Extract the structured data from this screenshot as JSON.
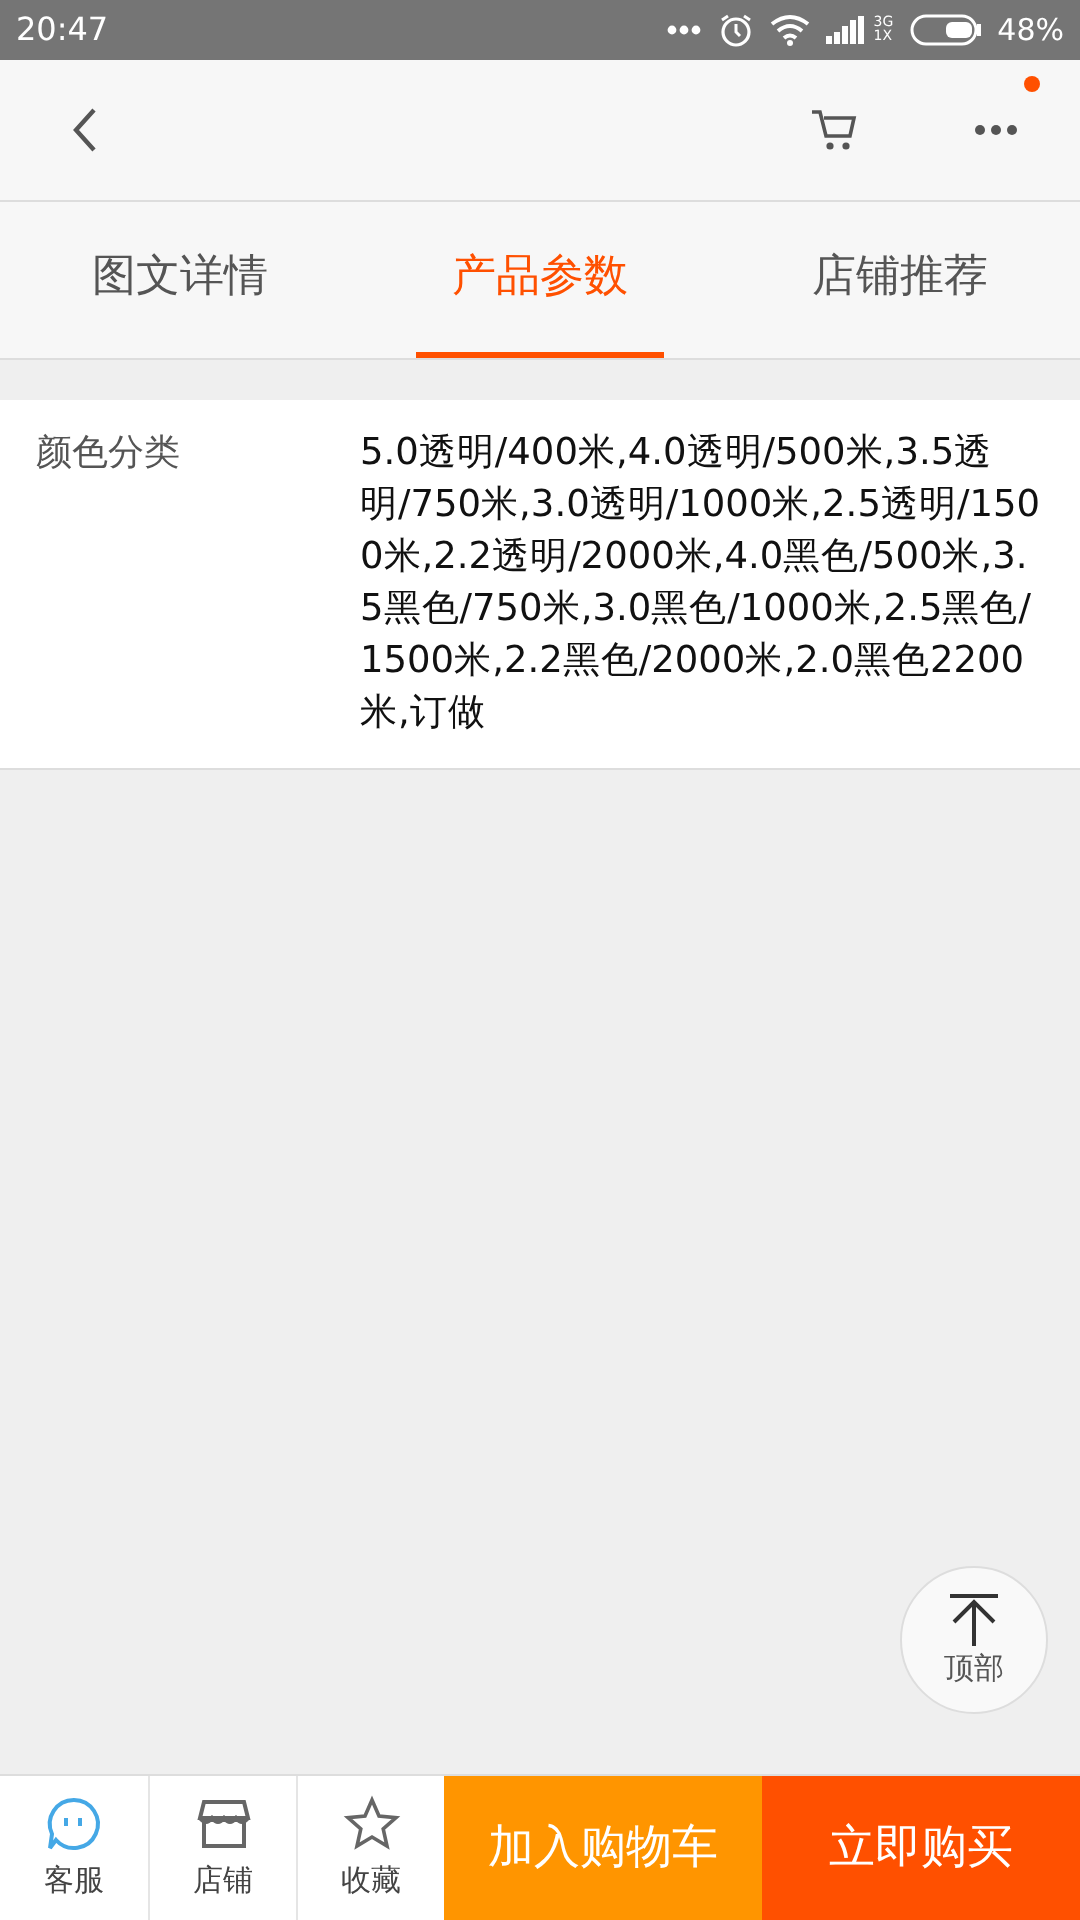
{
  "status_bar": {
    "time": "20:47",
    "network_type_top": "3G",
    "network_type_bottom": "1X",
    "battery": "48%"
  },
  "header": {
    "menu_badge": true
  },
  "tabs": [
    {
      "label": "图文详情",
      "selected": false
    },
    {
      "label": "产品参数",
      "selected": true
    },
    {
      "label": "店铺推荐",
      "selected": false
    }
  ],
  "params": [
    {
      "name": "颜色分类",
      "value": "5.0透明/400米,4.0透明/500米,3.5透明/750米,3.0透明/1000米,2.5透明/1500米,2.2透明/2000米,4.0黑色/500米,3.5黑色/750米,3.0黑色/1000米,2.5黑色/1500米,2.2黑色/2000米,2.0黑色2200米,订做"
    }
  ],
  "back_to_top": {
    "label": "顶部"
  },
  "bottom_bar": {
    "items": [
      {
        "kind": "service",
        "label": "客服"
      },
      {
        "kind": "shop",
        "label": "店铺"
      },
      {
        "kind": "favorite",
        "label": "收藏"
      }
    ],
    "buttons": [
      {
        "kind": "cart",
        "label": "加入购物车"
      },
      {
        "kind": "buy",
        "label": "立即购买"
      }
    ]
  }
}
